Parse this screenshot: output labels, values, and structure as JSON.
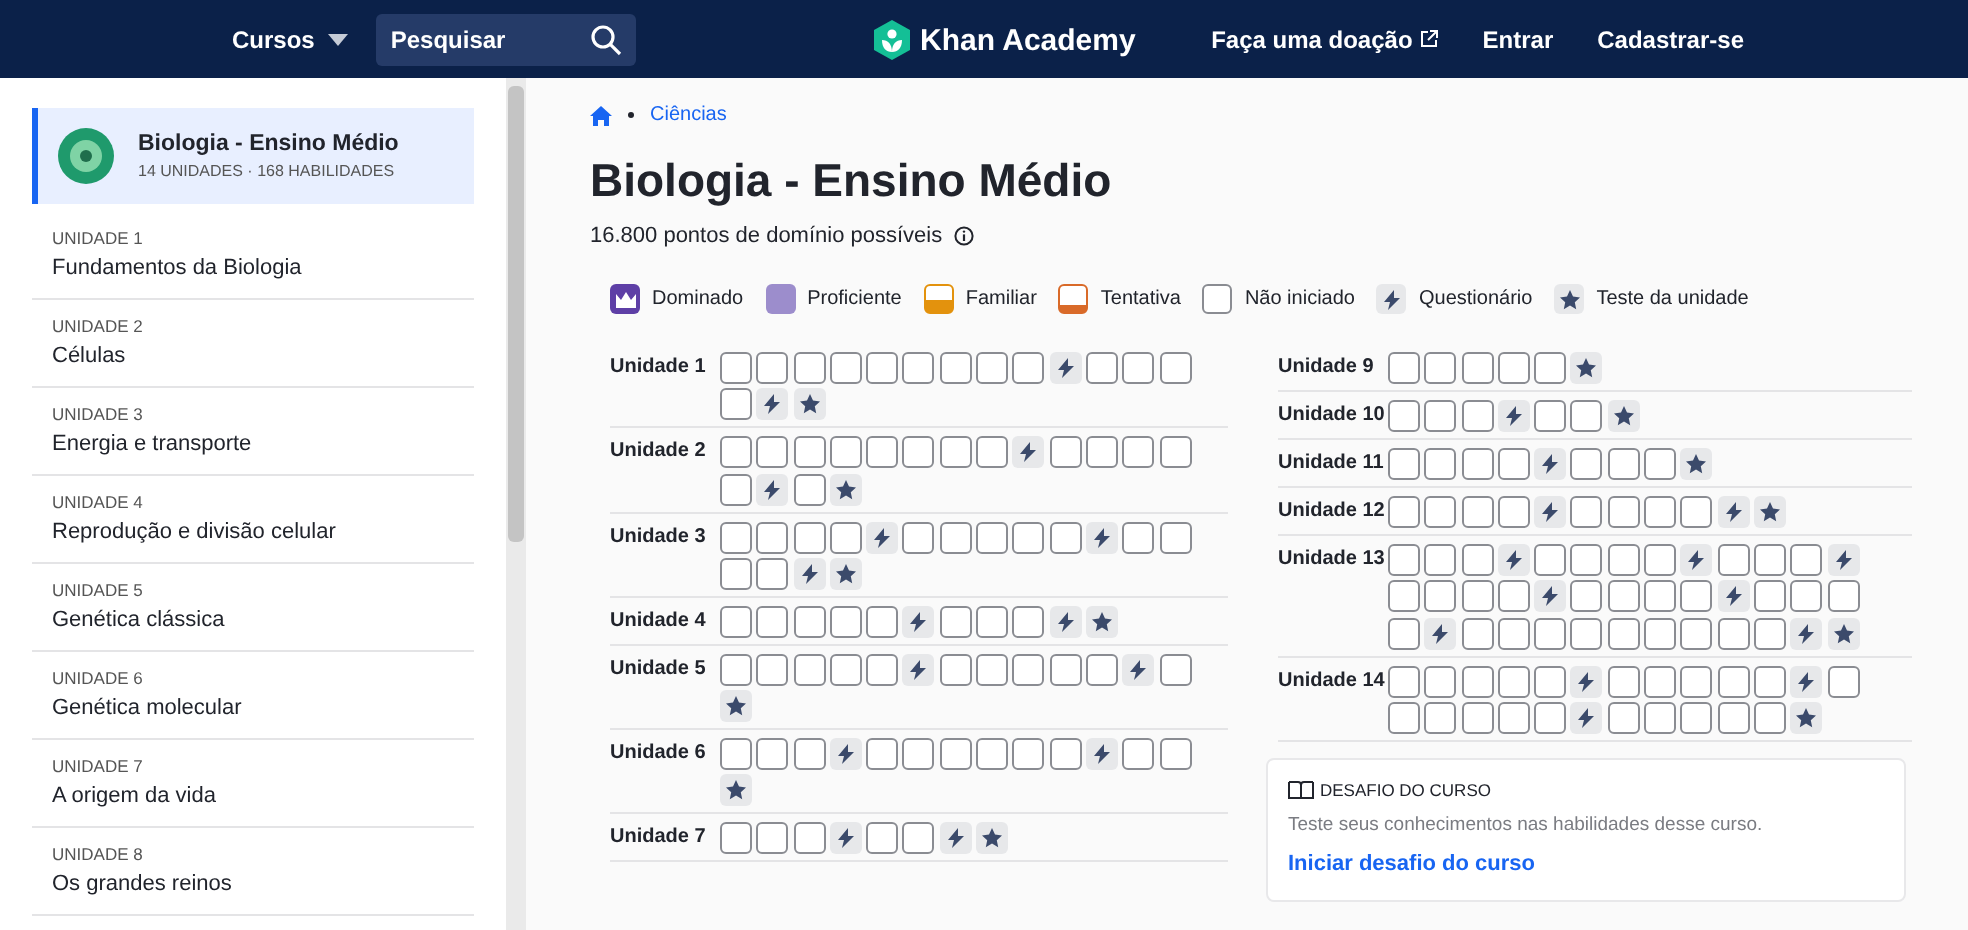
{
  "header": {
    "courses_menu": "Cursos",
    "search": {
      "placeholder": "Pesquisar"
    },
    "logo": "Khan Academy",
    "donate": "Faça uma doação",
    "login": "Entrar",
    "signup": "Cadastrar-se"
  },
  "sidebar": {
    "course": {
      "title": "Biologia - Ensino Médio",
      "subtitle": "14 UNIDADES · 168 HABILIDADES",
      "selected": true
    },
    "units": [
      {
        "label": "UNIDADE 1",
        "title": "Fundamentos da Biologia",
        "selected": false
      },
      {
        "label": "UNIDADE 2",
        "title": "Células",
        "selected": false
      },
      {
        "label": "UNIDADE 3",
        "title": "Energia e transporte",
        "selected": false
      },
      {
        "label": "UNIDADE 4",
        "title": "Reprodução e divisão celular",
        "selected": false
      },
      {
        "label": "UNIDADE 5",
        "title": "Genética clássica",
        "selected": false
      },
      {
        "label": "UNIDADE 6",
        "title": "Genética molecular",
        "selected": false
      },
      {
        "label": "UNIDADE 7",
        "title": "A origem da vida",
        "selected": false
      },
      {
        "label": "UNIDADE 8",
        "title": "Os grandes reinos",
        "selected": false
      }
    ]
  },
  "breadcrumb": [
    "Ciências"
  ],
  "title": "Biologia - Ensino Médio",
  "points": "16.800 pontos de domínio possíveis",
  "legend": [
    {
      "kind": "mastered",
      "label": "Dominado"
    },
    {
      "kind": "proficient",
      "label": "Proficiente"
    },
    {
      "kind": "familiar",
      "label": "Familiar"
    },
    {
      "kind": "attempted",
      "label": "Tentativa"
    },
    {
      "kind": "not_started",
      "label": "Não iniciado"
    },
    {
      "kind": "quiz",
      "label": "Questionário"
    },
    {
      "kind": "test",
      "label": "Teste da unidade"
    }
  ],
  "columns": [
    [
      {
        "name": "Unidade 1",
        "items": [
          {
            "kind": "skill"
          },
          {
            "kind": "skill"
          },
          {
            "kind": "skill"
          },
          {
            "kind": "skill"
          },
          {
            "kind": "skill"
          },
          {
            "kind": "skill"
          },
          {
            "kind": "skill"
          },
          {
            "kind": "skill"
          },
          {
            "kind": "skill"
          },
          {
            "kind": "quiz"
          },
          {
            "kind": "skill"
          },
          {
            "kind": "skill"
          },
          {
            "kind": "skill"
          },
          {
            "kind": "skill"
          },
          {
            "kind": "quiz"
          },
          {
            "kind": "test"
          }
        ]
      },
      {
        "name": "Unidade 2",
        "items": [
          {
            "kind": "skill"
          },
          {
            "kind": "skill"
          },
          {
            "kind": "skill"
          },
          {
            "kind": "skill"
          },
          {
            "kind": "skill"
          },
          {
            "kind": "skill"
          },
          {
            "kind": "skill"
          },
          {
            "kind": "skill"
          },
          {
            "kind": "quiz"
          },
          {
            "kind": "skill"
          },
          {
            "kind": "skill"
          },
          {
            "kind": "skill"
          },
          {
            "kind": "skill"
          },
          {
            "kind": "skill"
          },
          {
            "kind": "quiz"
          },
          {
            "kind": "skill"
          },
          {
            "kind": "test"
          }
        ]
      },
      {
        "name": "Unidade 3",
        "items": [
          {
            "kind": "skill"
          },
          {
            "kind": "skill"
          },
          {
            "kind": "skill"
          },
          {
            "kind": "skill"
          },
          {
            "kind": "quiz"
          },
          {
            "kind": "skill"
          },
          {
            "kind": "skill"
          },
          {
            "kind": "skill"
          },
          {
            "kind": "skill"
          },
          {
            "kind": "skill"
          },
          {
            "kind": "quiz"
          },
          {
            "kind": "skill"
          },
          {
            "kind": "skill"
          },
          {
            "kind": "skill"
          },
          {
            "kind": "skill"
          },
          {
            "kind": "quiz"
          },
          {
            "kind": "test"
          }
        ]
      },
      {
        "name": "Unidade 4",
        "items": [
          {
            "kind": "skill"
          },
          {
            "kind": "skill"
          },
          {
            "kind": "skill"
          },
          {
            "kind": "skill"
          },
          {
            "kind": "skill"
          },
          {
            "kind": "quiz"
          },
          {
            "kind": "skill"
          },
          {
            "kind": "skill"
          },
          {
            "kind": "skill"
          },
          {
            "kind": "quiz"
          },
          {
            "kind": "test"
          }
        ]
      },
      {
        "name": "Unidade 5",
        "items": [
          {
            "kind": "skill"
          },
          {
            "kind": "skill"
          },
          {
            "kind": "skill"
          },
          {
            "kind": "skill"
          },
          {
            "kind": "skill"
          },
          {
            "kind": "quiz"
          },
          {
            "kind": "skill"
          },
          {
            "kind": "skill"
          },
          {
            "kind": "skill"
          },
          {
            "kind": "skill"
          },
          {
            "kind": "skill"
          },
          {
            "kind": "quiz"
          },
          {
            "kind": "skill"
          },
          {
            "kind": "test"
          }
        ]
      },
      {
        "name": "Unidade 6",
        "items": [
          {
            "kind": "skill"
          },
          {
            "kind": "skill"
          },
          {
            "kind": "skill"
          },
          {
            "kind": "quiz"
          },
          {
            "kind": "skill"
          },
          {
            "kind": "skill"
          },
          {
            "kind": "skill"
          },
          {
            "kind": "skill"
          },
          {
            "kind": "skill"
          },
          {
            "kind": "skill"
          },
          {
            "kind": "quiz"
          },
          {
            "kind": "skill"
          },
          {
            "kind": "skill"
          },
          {
            "kind": "test"
          }
        ]
      },
      {
        "name": "Unidade 7",
        "items": [
          {
            "kind": "skill"
          },
          {
            "kind": "skill"
          },
          {
            "kind": "skill"
          },
          {
            "kind": "quiz"
          },
          {
            "kind": "skill"
          },
          {
            "kind": "skill"
          },
          {
            "kind": "quiz"
          },
          {
            "kind": "test"
          }
        ]
      }
    ],
    [
      {
        "name": "Unidade 9",
        "items": [
          {
            "kind": "skill"
          },
          {
            "kind": "skill"
          },
          {
            "kind": "skill"
          },
          {
            "kind": "skill"
          },
          {
            "kind": "skill"
          },
          {
            "kind": "test"
          }
        ]
      },
      {
        "name": "Unidade 10",
        "items": [
          {
            "kind": "skill"
          },
          {
            "kind": "skill"
          },
          {
            "kind": "skill"
          },
          {
            "kind": "quiz"
          },
          {
            "kind": "skill"
          },
          {
            "kind": "skill"
          },
          {
            "kind": "test"
          }
        ]
      },
      {
        "name": "Unidade 11",
        "items": [
          {
            "kind": "skill"
          },
          {
            "kind": "skill"
          },
          {
            "kind": "skill"
          },
          {
            "kind": "skill"
          },
          {
            "kind": "quiz"
          },
          {
            "kind": "skill"
          },
          {
            "kind": "skill"
          },
          {
            "kind": "skill"
          },
          {
            "kind": "test"
          }
        ]
      },
      {
        "name": "Unidade 12",
        "items": [
          {
            "kind": "skill"
          },
          {
            "kind": "skill"
          },
          {
            "kind": "skill"
          },
          {
            "kind": "skill"
          },
          {
            "kind": "quiz"
          },
          {
            "kind": "skill"
          },
          {
            "kind": "skill"
          },
          {
            "kind": "skill"
          },
          {
            "kind": "skill"
          },
          {
            "kind": "quiz"
          },
          {
            "kind": "test"
          }
        ]
      },
      {
        "name": "Unidade 13",
        "items": [
          {
            "kind": "skill"
          },
          {
            "kind": "skill"
          },
          {
            "kind": "skill"
          },
          {
            "kind": "quiz"
          },
          {
            "kind": "skill"
          },
          {
            "kind": "skill"
          },
          {
            "kind": "skill"
          },
          {
            "kind": "skill"
          },
          {
            "kind": "quiz"
          },
          {
            "kind": "skill"
          },
          {
            "kind": "skill"
          },
          {
            "kind": "skill"
          },
          {
            "kind": "quiz"
          },
          {
            "kind": "skill"
          },
          {
            "kind": "skill"
          },
          {
            "kind": "skill"
          },
          {
            "kind": "skill"
          },
          {
            "kind": "quiz"
          },
          {
            "kind": "skill"
          },
          {
            "kind": "skill"
          },
          {
            "kind": "skill"
          },
          {
            "kind": "skill"
          },
          {
            "kind": "quiz"
          },
          {
            "kind": "skill"
          },
          {
            "kind": "skill"
          },
          {
            "kind": "skill"
          },
          {
            "kind": "skill"
          },
          {
            "kind": "quiz"
          },
          {
            "kind": "skill"
          },
          {
            "kind": "skill"
          },
          {
            "kind": "skill"
          },
          {
            "kind": "skill"
          },
          {
            "kind": "skill"
          },
          {
            "kind": "skill"
          },
          {
            "kind": "skill"
          },
          {
            "kind": "skill"
          },
          {
            "kind": "skill"
          },
          {
            "kind": "quiz"
          },
          {
            "kind": "test"
          }
        ]
      },
      {
        "name": "Unidade 14",
        "items": [
          {
            "kind": "skill"
          },
          {
            "kind": "skill"
          },
          {
            "kind": "skill"
          },
          {
            "kind": "skill"
          },
          {
            "kind": "skill"
          },
          {
            "kind": "quiz"
          },
          {
            "kind": "skill"
          },
          {
            "kind": "skill"
          },
          {
            "kind": "skill"
          },
          {
            "kind": "skill"
          },
          {
            "kind": "skill"
          },
          {
            "kind": "quiz"
          },
          {
            "kind": "skill"
          },
          {
            "kind": "skill"
          },
          {
            "kind": "skill"
          },
          {
            "kind": "skill"
          },
          {
            "kind": "skill"
          },
          {
            "kind": "skill"
          },
          {
            "kind": "quiz"
          },
          {
            "kind": "skill"
          },
          {
            "kind": "skill"
          },
          {
            "kind": "skill"
          },
          {
            "kind": "skill"
          },
          {
            "kind": "skill"
          },
          {
            "kind": "test"
          }
        ]
      }
    ]
  ],
  "challenge": {
    "title": "DESAFIO DO CURSO",
    "text": "Teste seus conhecimentos nas habilidades desse curso.",
    "link": "Iniciar desafio do curso"
  }
}
